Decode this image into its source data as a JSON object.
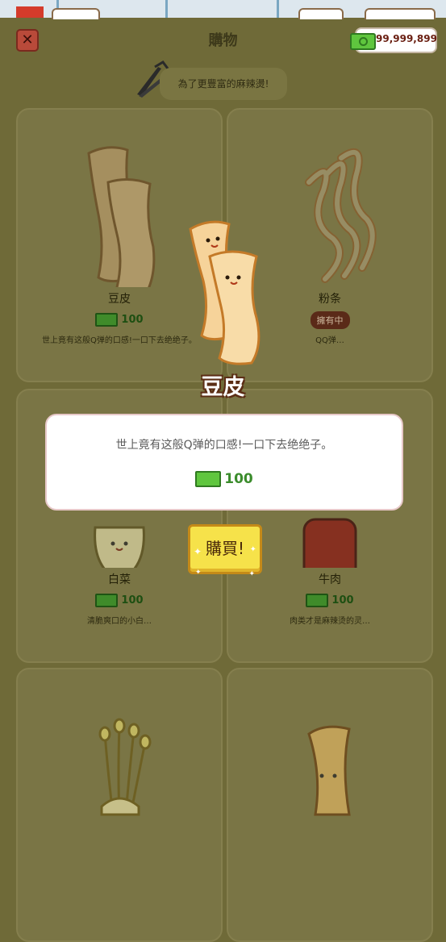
{
  "header": {
    "title": "購物",
    "money": "99,999,899",
    "close_label": "✕"
  },
  "hint": {
    "text": "為了更豐富的麻辣燙!"
  },
  "items": [
    {
      "name": "豆皮",
      "price": "100",
      "owned": false,
      "desc": "世上竟有这般Q弹的口感!一口下去绝绝子。"
    },
    {
      "name": "粉条",
      "price": "",
      "owned": true,
      "owned_label": "擁有中",
      "desc": "QQ弹…"
    },
    {
      "name": "白菜",
      "price": "100",
      "owned": false,
      "desc": "清脆爽口的小白…"
    },
    {
      "name": "牛肉",
      "price": "100",
      "owned": false,
      "desc": "肉类才是麻辣烫的灵…"
    },
    {
      "name": "",
      "price": "",
      "owned": false,
      "desc": ""
    },
    {
      "name": "",
      "price": "",
      "owned": false,
      "desc": ""
    }
  ],
  "selected": {
    "name": "豆皮",
    "desc": "世上竟有这般Q弹的口感!一口下去绝绝子。",
    "price": "100",
    "buy_label": "購買!"
  },
  "colors": {
    "overlay_bg": "#6f6a38",
    "money_green": "#5fc63e",
    "buy_yellow": "#f6e24a"
  },
  "icons": [
    "close-icon",
    "cash-icon",
    "tongs-icon",
    "sparkle-icon"
  ]
}
